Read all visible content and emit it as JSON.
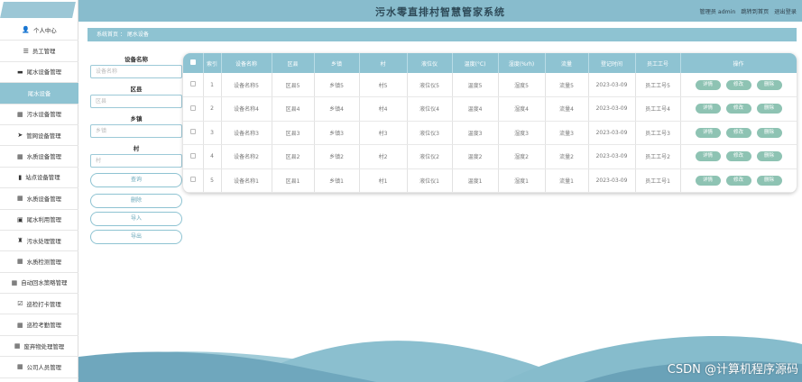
{
  "app": {
    "logo_text": "",
    "title": "污水零直排村智慧管家系统"
  },
  "header": {
    "admin_label": "管理员 admin",
    "to_front": "跳转到首页",
    "logout": "退出登录"
  },
  "sidebar": {
    "items": [
      {
        "label": "个人中心",
        "icon": "person-icon",
        "glyph": "👤",
        "active": false
      },
      {
        "label": "员工管理",
        "icon": "list-icon",
        "glyph": "☰",
        "active": false
      },
      {
        "label": "尾水设备管理",
        "icon": "briefcase-icon",
        "glyph": "▬",
        "active": false
      },
      {
        "label": "尾水设备",
        "icon": "",
        "glyph": "",
        "active": true
      },
      {
        "label": "污水设备管理",
        "icon": "grid-icon",
        "glyph": "▦",
        "active": false
      },
      {
        "label": "管网设备管理",
        "icon": "send-icon",
        "glyph": "➤",
        "active": false
      },
      {
        "label": "水质设备管理",
        "icon": "grid-icon",
        "glyph": "▦",
        "active": false
      },
      {
        "label": "站点设备管理",
        "icon": "chart-icon",
        "glyph": "▮",
        "active": false
      },
      {
        "label": "水质设备管理",
        "icon": "grid-icon",
        "glyph": "▦",
        "active": false
      },
      {
        "label": "尾水利用管理",
        "icon": "clipboard-icon",
        "glyph": "▣",
        "active": false
      },
      {
        "label": "污水处理管理",
        "icon": "trophy-icon",
        "glyph": "♜",
        "active": false
      },
      {
        "label": "水质检测管理",
        "icon": "grid-icon",
        "glyph": "▦",
        "active": false
      },
      {
        "label": "自动回水策略管理",
        "icon": "grid-icon",
        "glyph": "▦",
        "active": false
      },
      {
        "label": "巡检打卡管理",
        "icon": "checkbox-icon",
        "glyph": "☑",
        "active": false
      },
      {
        "label": "巡检考勤管理",
        "icon": "grid-icon",
        "glyph": "▦",
        "active": false
      },
      {
        "label": "废弃物处理管理",
        "icon": "grid-icon",
        "glyph": "▦",
        "active": false
      },
      {
        "label": "公司人员管理",
        "icon": "grid-icon",
        "glyph": "▦",
        "active": false
      }
    ]
  },
  "breadcrumb": {
    "home": "系统首页",
    "sep": "：",
    "current": "尾水设备"
  },
  "search": {
    "fields": [
      {
        "label": "设备名称",
        "placeholder": "设备名称"
      },
      {
        "label": "区县",
        "placeholder": "区县"
      },
      {
        "label": "乡镇",
        "placeholder": "乡镇"
      },
      {
        "label": "村",
        "placeholder": "村"
      }
    ],
    "search_btn": "查询",
    "delete_btn": "删除",
    "import_btn": "导入",
    "export_btn": "导出"
  },
  "table": {
    "headers": [
      "索引",
      "设备名称",
      "区县",
      "乡镇",
      "村",
      "液位仪",
      "温度(°C)",
      "湿度(%rh)",
      "流量",
      "登记时间",
      "员工工号",
      "操作"
    ],
    "rows": [
      [
        "1",
        "设备名称5",
        "区县5",
        "乡镇5",
        "村5",
        "液位仪5",
        "温度5",
        "湿度5",
        "流量5",
        "2023-03-09",
        "员工工号5"
      ],
      [
        "2",
        "设备名称4",
        "区县4",
        "乡镇4",
        "村4",
        "液位仪4",
        "温度4",
        "湿度4",
        "流量4",
        "2023-03-09",
        "员工工号4"
      ],
      [
        "3",
        "设备名称3",
        "区县3",
        "乡镇3",
        "村3",
        "液位仪3",
        "温度3",
        "湿度3",
        "流量3",
        "2023-03-09",
        "员工工号3"
      ],
      [
        "4",
        "设备名称2",
        "区县2",
        "乡镇2",
        "村2",
        "液位仪2",
        "温度2",
        "湿度2",
        "流量2",
        "2023-03-09",
        "员工工号2"
      ],
      [
        "5",
        "设备名称1",
        "区县1",
        "乡镇1",
        "村1",
        "液位仪1",
        "温度1",
        "湿度1",
        "流量1",
        "2023-03-09",
        "员工工号1"
      ]
    ],
    "actions": [
      "详情",
      "修改",
      "删除"
    ]
  },
  "watermark": "CSDN @计算机程序源码",
  "colors": {
    "accent": "#8ec3d2",
    "header": "#88bccd",
    "action": "#8ec3b3",
    "title": "#2e4a58"
  }
}
